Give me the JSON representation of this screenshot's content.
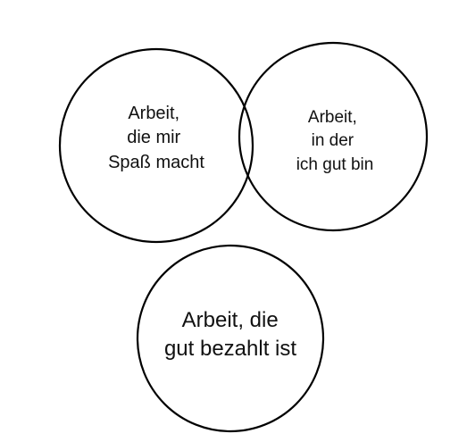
{
  "diagram": {
    "circles": [
      {
        "id": "fun",
        "lines": [
          "Arbeit,",
          "die mir",
          "Spaß macht"
        ]
      },
      {
        "id": "skill",
        "lines": [
          "Arbeit,",
          "in der",
          "ich gut bin"
        ]
      },
      {
        "id": "pay",
        "lines": [
          "Arbeit, die",
          "gut bezahlt ist"
        ]
      }
    ],
    "colors": {
      "stroke": "#000000",
      "text": "#111111",
      "background": "#ffffff"
    }
  }
}
